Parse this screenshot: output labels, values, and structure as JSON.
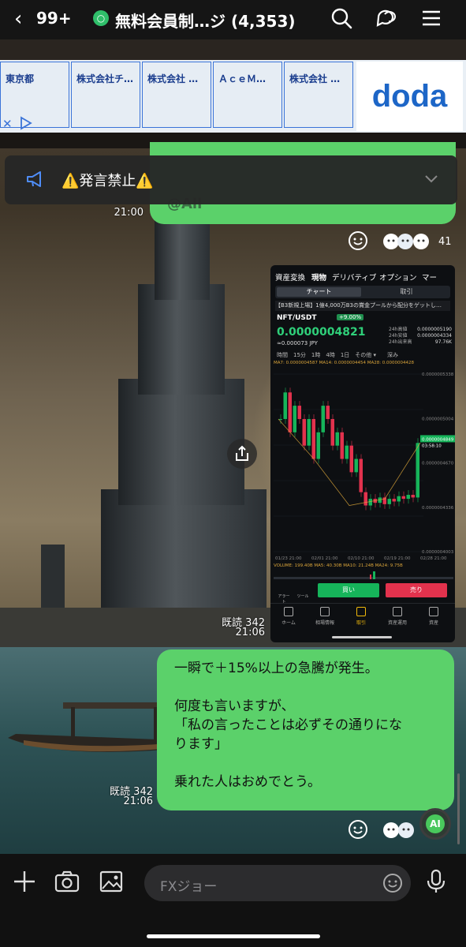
{
  "header": {
    "back_count": "99+",
    "title": "無料会員制…ジ (4,353)"
  },
  "ad": {
    "cards": [
      "東京都",
      "株式会社チ…",
      "株式会社 …",
      "ＡｃｅＭ…",
      "株式会社 …"
    ],
    "brand": "doda",
    "close_glyph": "✕"
  },
  "notice": {
    "text": "⚠️発言禁止⚠️"
  },
  "messages": {
    "top_bubble_mention": "@All",
    "top_time": "21:00",
    "top_reaction_count": "41",
    "image_read": "既読 342",
    "image_time": "21:06",
    "text_read": "既読 342",
    "text_time": "21:06",
    "text_lines": [
      "一瞬で＋15%以上の急騰が発生。",
      "",
      "何度も言いますが、",
      "「私の言ったことは必ずその通りにな",
      "ります」",
      "",
      "乗れた人はおめでとう。"
    ]
  },
  "screenshot": {
    "tabs": [
      "資産変換",
      "現物",
      "デリバティブ",
      "オプション",
      "マー"
    ],
    "seg_on": "チャート",
    "seg_off": "取引",
    "announcement": "【B3新規上場】1億4,000万B3の賞金プールから配分をゲットし…",
    "pair": "NFT/USDT",
    "change": "+9.00%",
    "price": "0.0000004821",
    "price_jpy": "≈0.000073 JPY",
    "stats": [
      {
        "k": "24h高値",
        "v": "0.0000005190"
      },
      {
        "k": "24h安値",
        "v": "0.0000004334"
      },
      {
        "k": "24h出来高",
        "v": "97.76K"
      }
    ],
    "timeframes": "時間　15分　1時　4時　1日　その他 ▾　　深み",
    "ma_row": "MA7: 0.0000004587  MA14: 0.0000004454  MA28: 0.0000004428",
    "price_labels": [
      "0.0000005338",
      "0.0000005004",
      "0.0000004849",
      "03:58:10",
      "0.0000004670",
      "0.0000004336",
      "0.0000004003"
    ],
    "date_labels": [
      "01/23 21:00",
      "02/01 21:00",
      "02/10 21:00",
      "02/19 21:00",
      "02/28 21:00"
    ],
    "vol_row": "VOLUME: 199.40B  MA5: 40.30B  MA10: 21.24B  MA24: 9.75B",
    "buy": "買い",
    "sell": "売り",
    "mini_tools": [
      "アラート",
      "ツール"
    ],
    "nav": [
      "ホーム",
      "相場情報",
      "取引",
      "資産運用",
      "資産"
    ],
    "chart_data": {
      "type": "line",
      "title": "NFT/USDT",
      "xlabel": "",
      "ylabel": "",
      "x": [
        "01/23 21:00",
        "02/01 21:00",
        "02/10 21:00",
        "02/19 21:00",
        "02/28 21:00"
      ],
      "series": [
        {
          "name": "NFT/USDT",
          "values": [
            5e-07,
            4.7e-07,
            4.35e-07,
            4.4e-07,
            4.821e-07
          ]
        }
      ],
      "ylim": [
        4.003e-07,
        5.338e-07
      ]
    }
  },
  "input": {
    "placeholder": "FXジョー"
  },
  "ai_label": "AI"
}
